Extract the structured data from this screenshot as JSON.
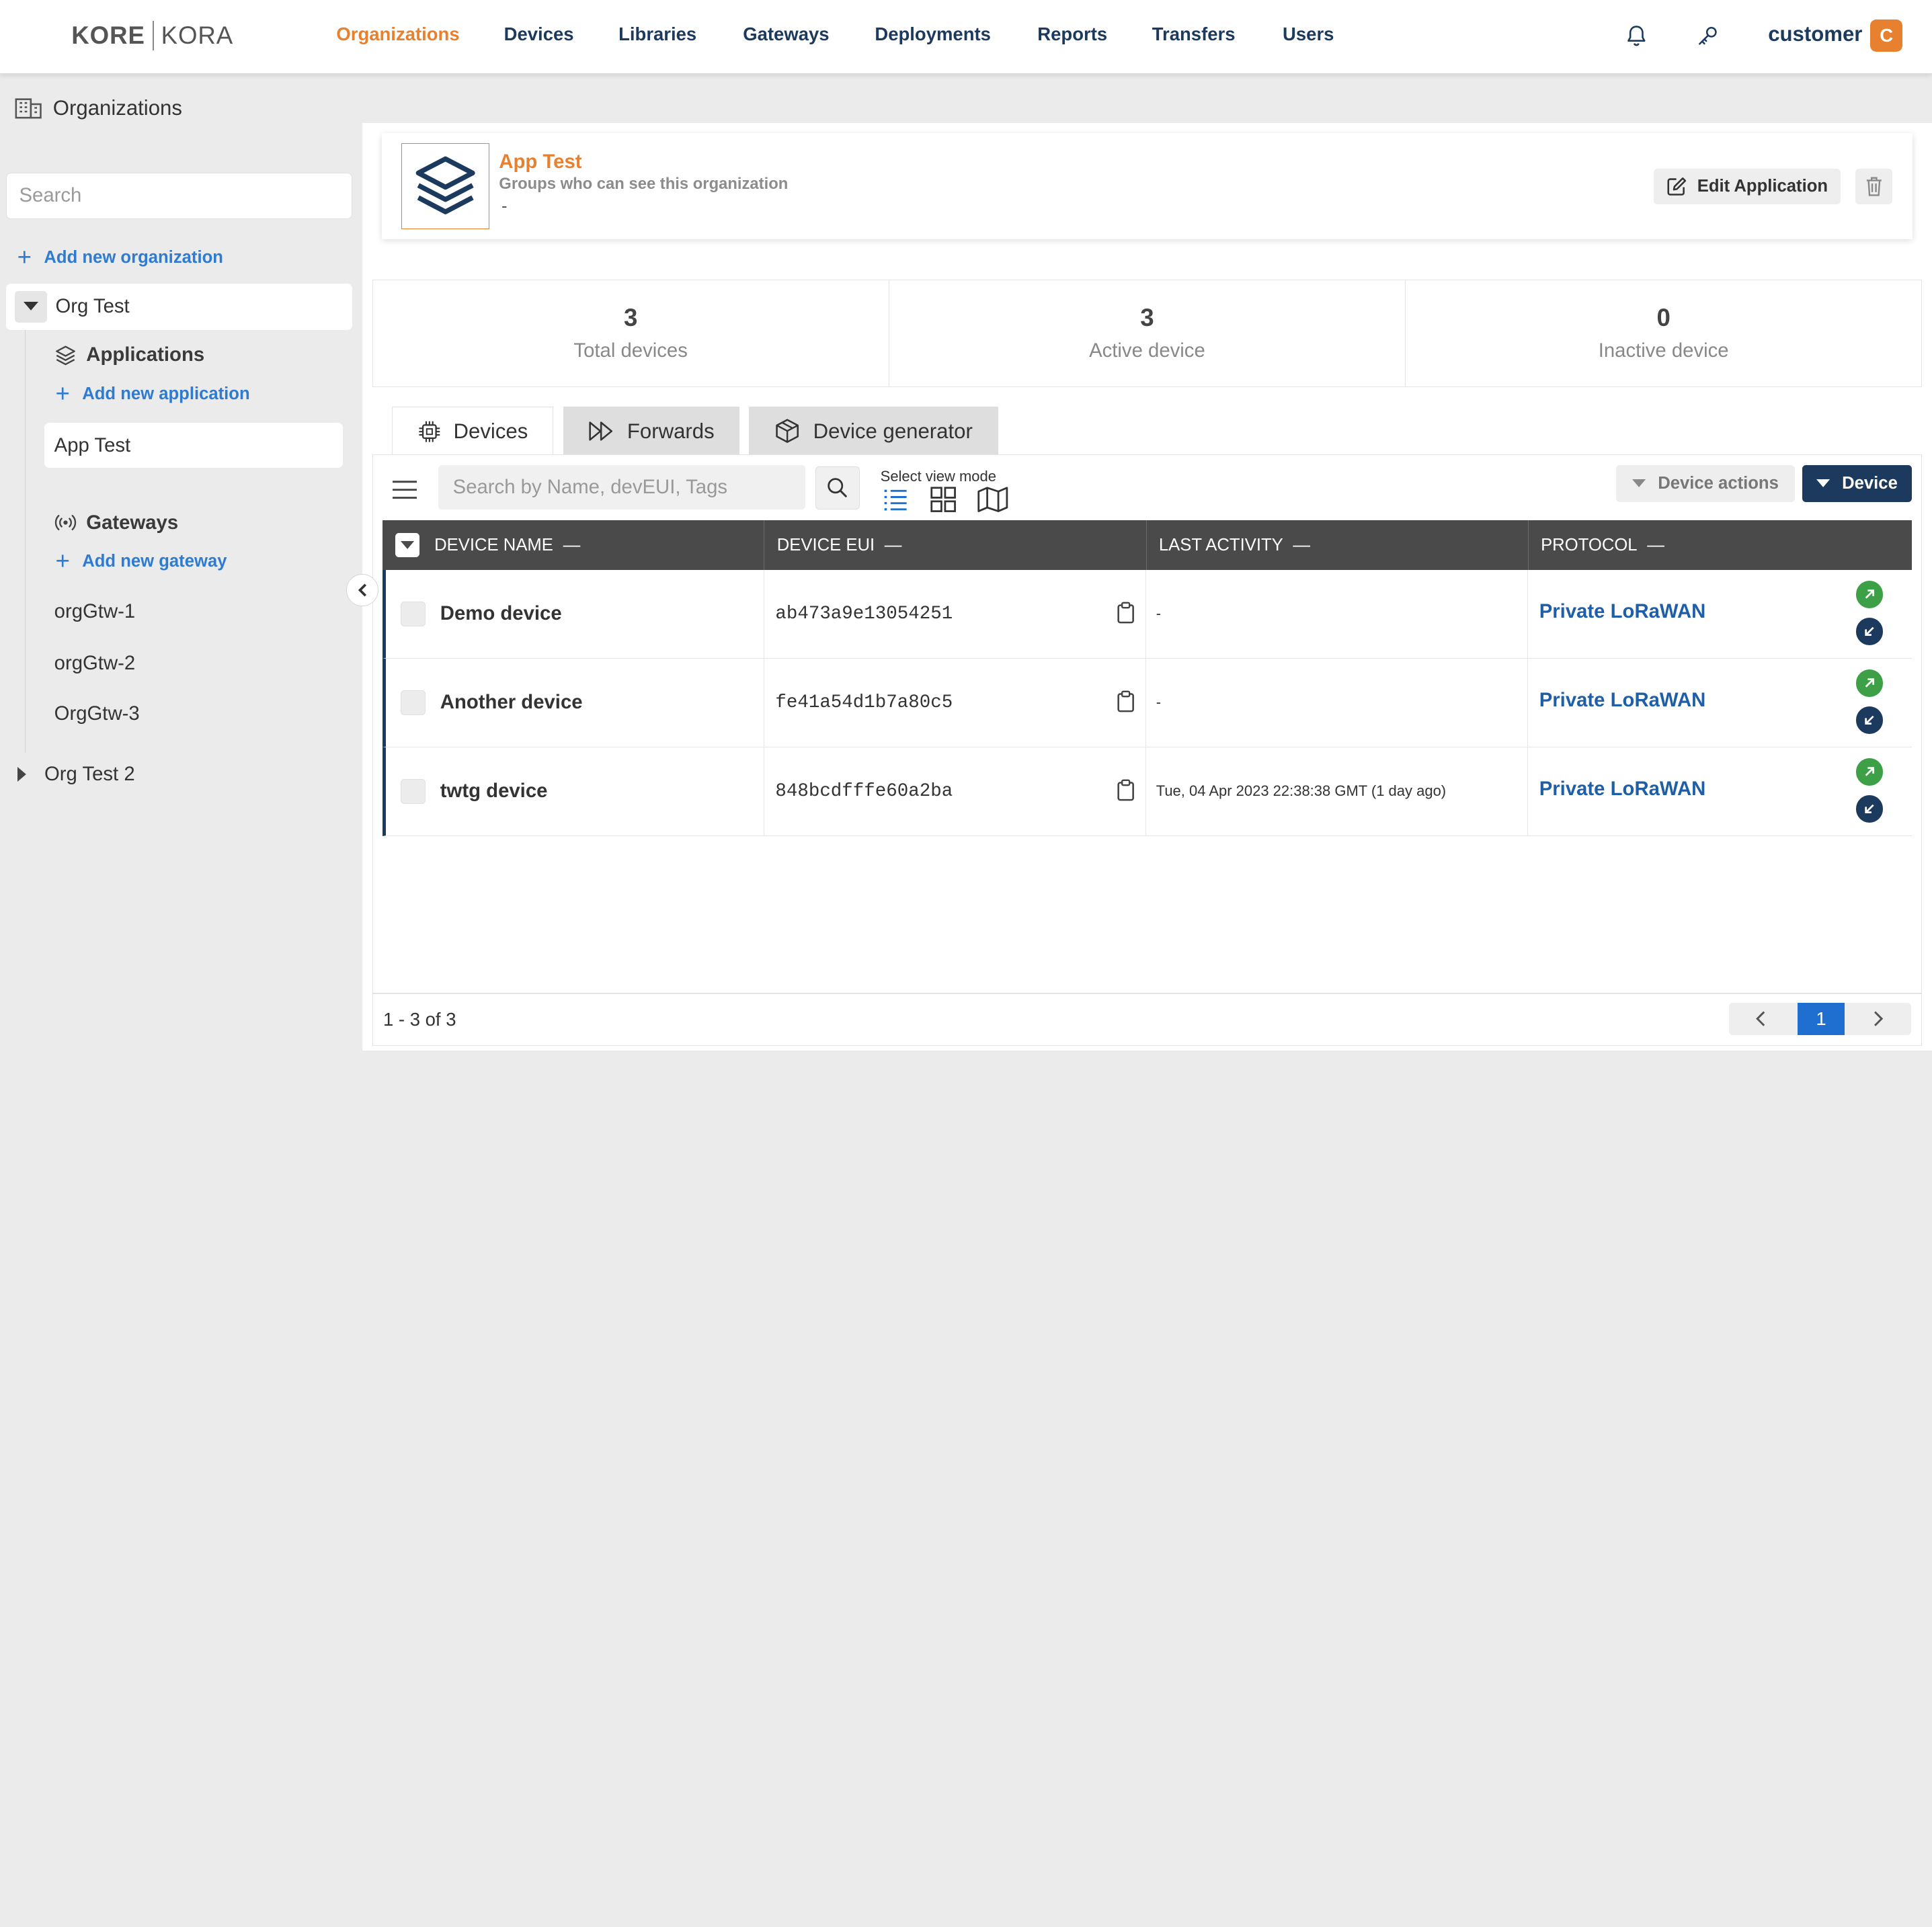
{
  "brand": {
    "left": "KORE",
    "right": "KORA"
  },
  "nav": [
    {
      "label": "Organizations",
      "active": true
    },
    {
      "label": "Devices"
    },
    {
      "label": "Libraries"
    },
    {
      "label": "Gateways"
    },
    {
      "label": "Deployments"
    },
    {
      "label": "Reports"
    },
    {
      "label": "Transfers"
    },
    {
      "label": "Users"
    }
  ],
  "header_icons": [
    "bell-icon",
    "key-icon"
  ],
  "user": {
    "name": "customer",
    "initial": "C"
  },
  "sidebar": {
    "title": "Organizations",
    "search_placeholder": "Search",
    "add_org": "Add new organization",
    "org": "Org Test",
    "applications_label": "Applications",
    "add_application": "Add new application",
    "application": "App Test",
    "gateways_label": "Gateways",
    "add_gateway": "Add new gateway",
    "gateways": [
      "orgGtw-1",
      "orgGtw-2",
      "OrgGtw-3"
    ],
    "org2": "Org Test 2"
  },
  "app": {
    "name": "App Test",
    "groups_label": "Groups who can see this organization",
    "groups_value": "-",
    "edit_label": "Edit Application"
  },
  "stats": [
    {
      "value": "3",
      "label": "Total devices"
    },
    {
      "value": "3",
      "label": "Active device"
    },
    {
      "value": "0",
      "label": "Inactive device"
    }
  ],
  "tabs": [
    {
      "label": "Devices",
      "active": true
    },
    {
      "label": "Forwards"
    },
    {
      "label": "Device generator"
    }
  ],
  "toolbar": {
    "search_placeholder": "Search by Name, devEUI, Tags",
    "view_mode_label": "Select view mode",
    "device_actions": "Device actions",
    "device_button": "Device"
  },
  "table": {
    "columns": [
      "DEVICE NAME",
      "DEVICE EUI",
      "LAST ACTIVITY",
      "PROTOCOL"
    ],
    "column_suffix": "—",
    "rows": [
      {
        "name": "Demo device",
        "eui": "ab473a9e13054251",
        "activity": "-",
        "protocol": "Private LoRaWAN"
      },
      {
        "name": "Another device",
        "eui": "fe41a54d1b7a80c5",
        "activity": "-",
        "protocol": "Private LoRaWAN"
      },
      {
        "name": "twtg device",
        "eui": "848bcdfffe60a2ba",
        "activity": "Tue, 04 Apr 2023 22:38:38 GMT (1 day ago)",
        "protocol": "Private LoRaWAN"
      }
    ]
  },
  "pagination": {
    "info": "1 - 3 of 3",
    "current": "1"
  },
  "colors": {
    "accent": "#e8812f",
    "navy": "#1c3a5e",
    "link": "#2e7bd1",
    "green": "#3da047",
    "page_blue": "#1f6fd1"
  }
}
